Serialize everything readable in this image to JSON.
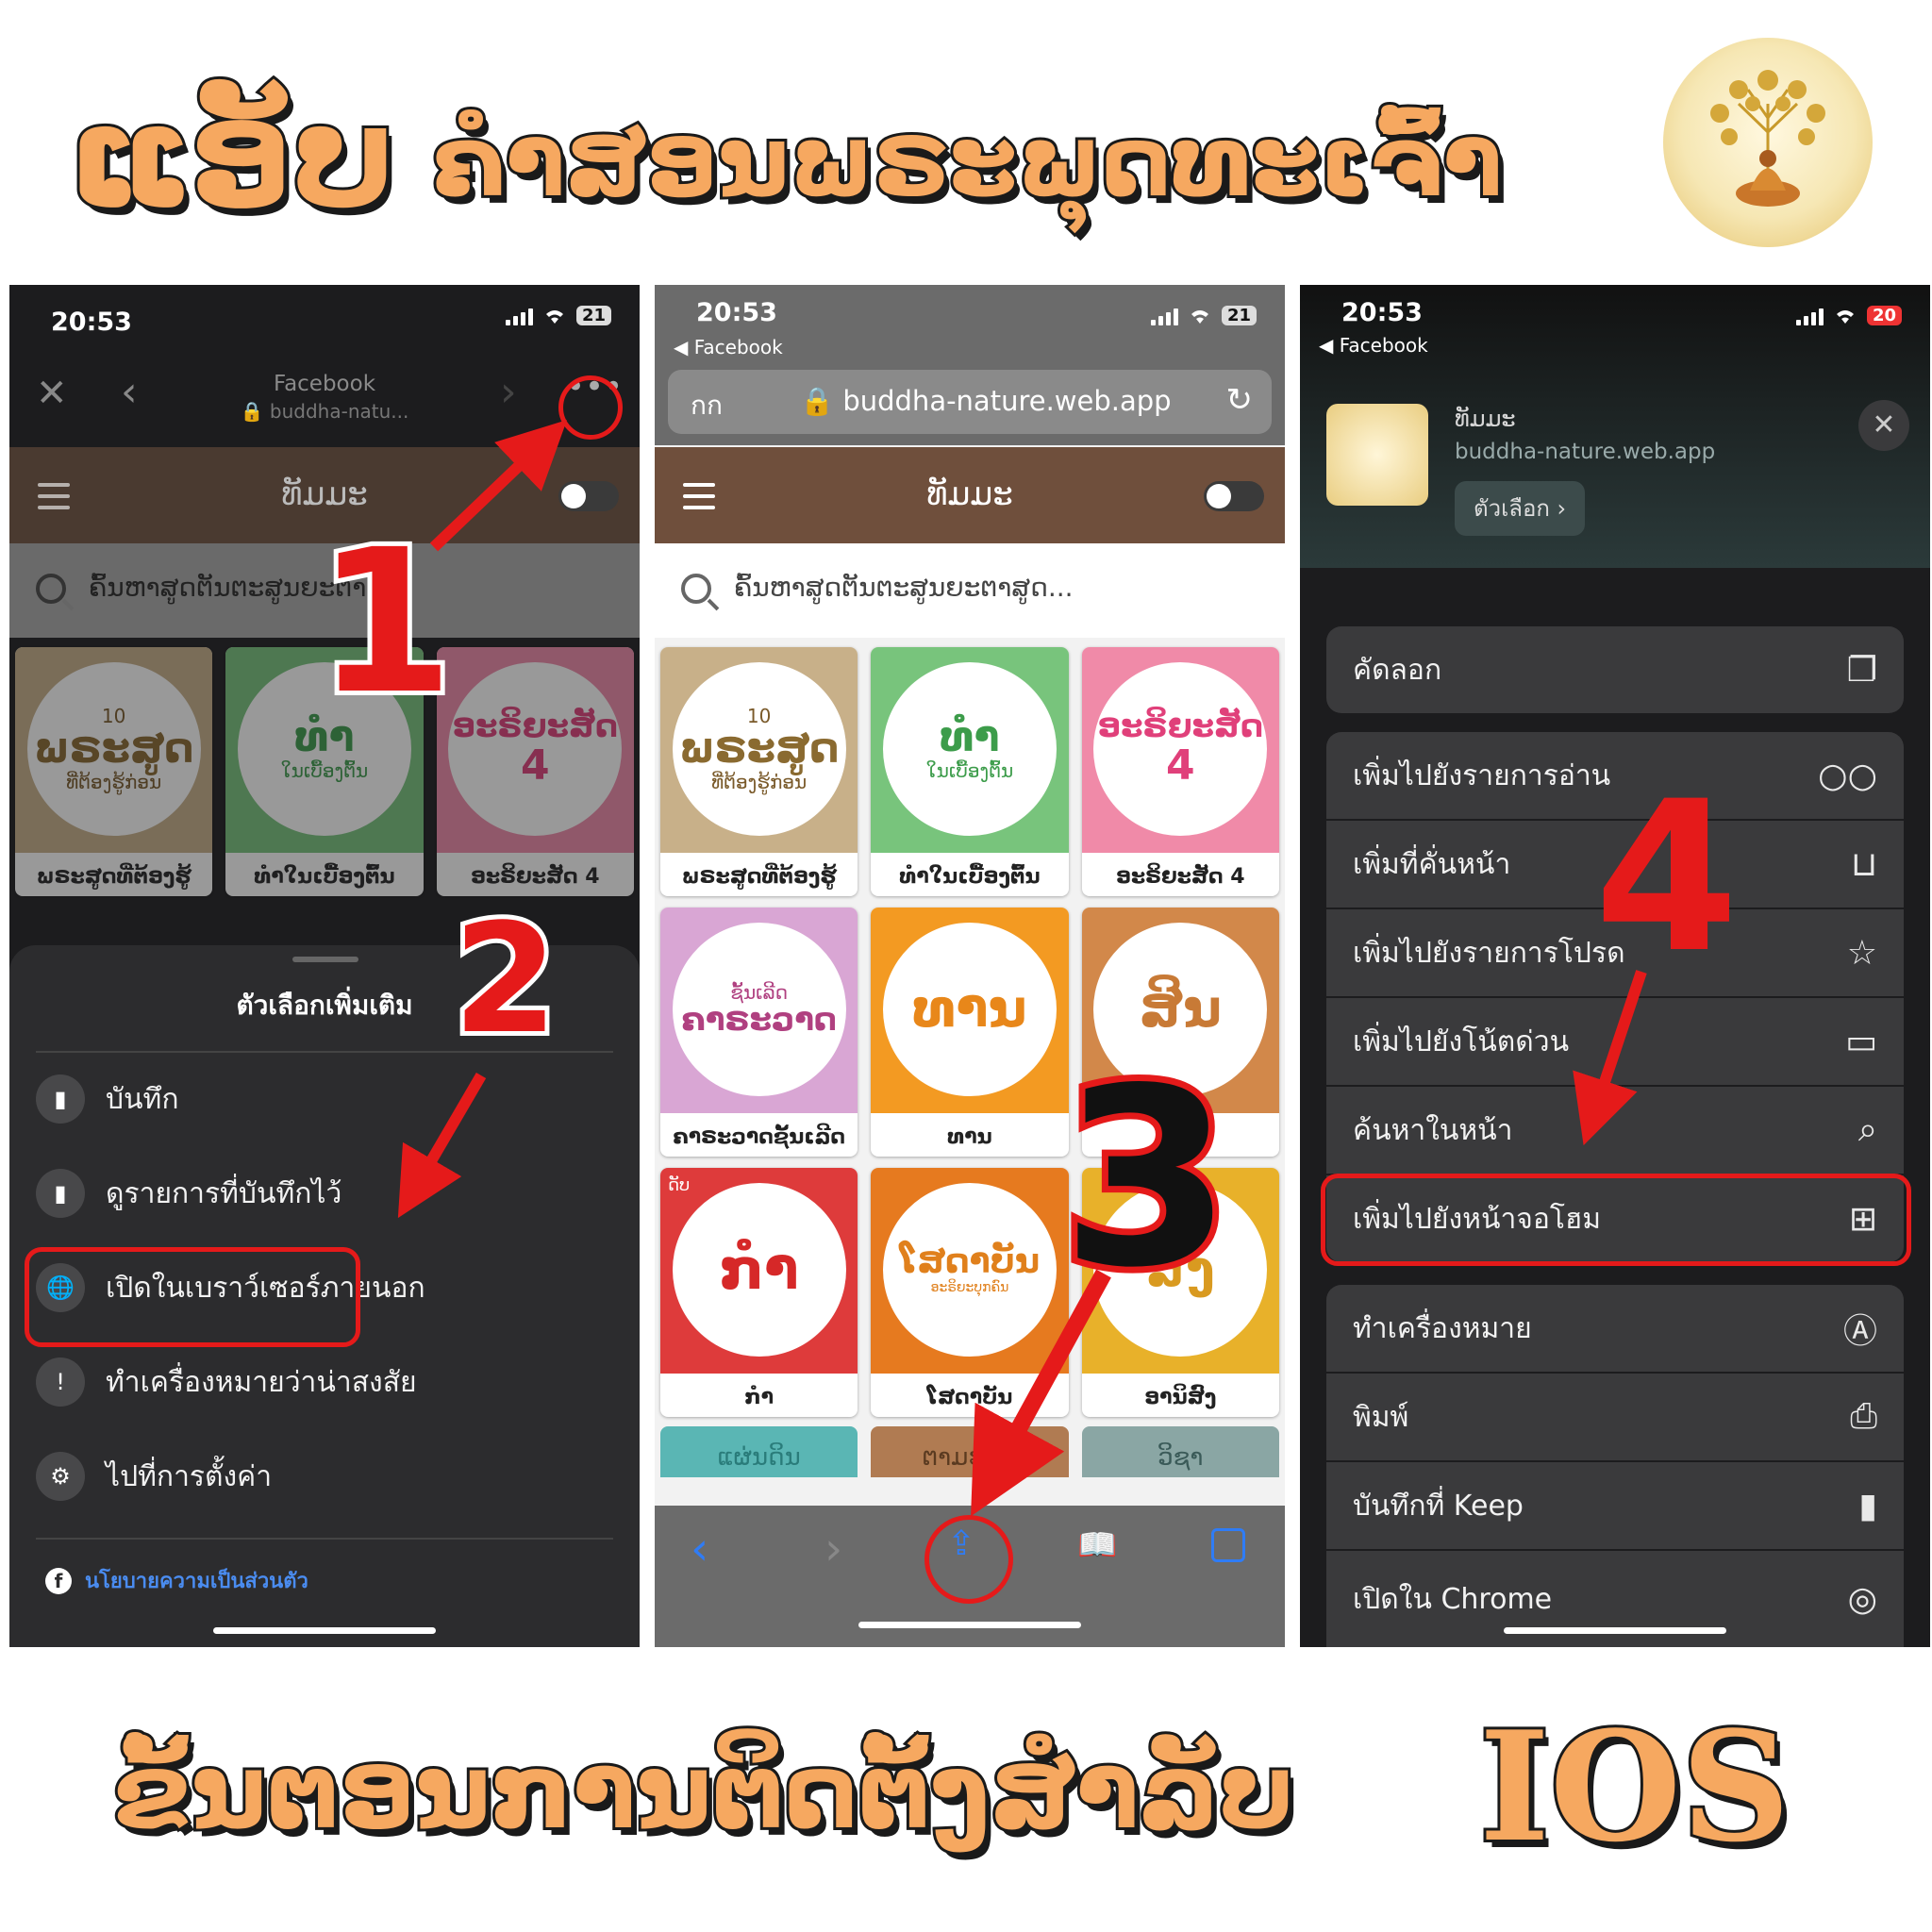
{
  "header": {
    "title_app": "ແອັບ",
    "title_rest": "ຄຳສອນພຣະພຸດທະເຈົ້າ"
  },
  "footer": {
    "title": "ຂັ້ນຕອນການຕິດຕັ້ງສຳລັບ",
    "ios": "IOS"
  },
  "steps": [
    "1",
    "2",
    "3",
    "4"
  ],
  "colors": {
    "accent": "#f6a860",
    "red": "#e51a1a",
    "brown": "#6f4f3c",
    "sheet": "#2c2c2e"
  },
  "phone1": {
    "time": "20:53",
    "battery": "21",
    "browser_title": "Facebook",
    "browser_url": "buddha-natu...",
    "app_title": "ທັມມະ",
    "search_placeholder": "ຄົ້ນຫາສູດຕັນຕະສູນຍະຕາ...",
    "cards": [
      {
        "main": "ພຣະສູດ",
        "top": "10",
        "sub": "ທີ່ຕ້ອງຮູ້ກ່ອນ",
        "label": "ພຣະສູດທີ່ຕ້ອງຮູ້"
      },
      {
        "main": "ທຳ",
        "top": "",
        "sub": "ໃນເບື້ອງຕົ້ນ",
        "label": "ທຳໃນເບື້ອງຕົ້ນ"
      },
      {
        "main": "ອະຣິຍະສັດ",
        "top": "",
        "sub": "4",
        "label": "ອະຣິຍະສັດ 4"
      }
    ],
    "sheet_title": "ตัวเลือกเพิ่มเติม",
    "menu": [
      {
        "icon": "bookmark-icon",
        "label": "บันทึก"
      },
      {
        "icon": "saved-list-icon",
        "label": "ดูรายการที่บันทึกไว้"
      },
      {
        "icon": "globe-icon",
        "label": "เปิดในเบราว์เซอร์ภายนอก"
      },
      {
        "icon": "alert-icon",
        "label": "ทำเครื่องหมายว่าน่าสงสัย"
      },
      {
        "icon": "gear-icon",
        "label": "ไปที่การตั้งค่า"
      }
    ],
    "privacy": "นโยบายความเป็นส่วนตัว"
  },
  "phone2": {
    "time": "20:53",
    "back_app": "◀ Facebook",
    "battery": "21",
    "aa": "กก",
    "url": "buddha-nature.web.app",
    "app_title": "ທັມມະ",
    "search_placeholder": "ຄົ້ນຫາສູດຕັນຕະສູນຍະຕາສູດ...",
    "cards": [
      {
        "main": "ພຣະສູດ",
        "top": "10",
        "sub": "ທີ່ຕ້ອງຮູ້ກ່ອນ",
        "label": "ພຣະສູດທີ່ຕ້ອງຮູ້",
        "bg": "#c8b089"
      },
      {
        "main": "ທຳ",
        "top": "",
        "sub": "ໃນເບື້ອງຕົ້ນ",
        "label": "ທຳໃນເບື້ອງຕົ້ນ",
        "bg": "#78c47c"
      },
      {
        "main": "ອະຣິຍະສັດ",
        "top": "",
        "sub": "4",
        "label": "ອະຣິຍະສັດ 4",
        "bg": "#f08aa8"
      },
      {
        "main": "ຄາຣະວາດ",
        "top": "ຊັ້ນເລີດ",
        "sub": "",
        "label": "ຄາຣະວາດຊັ້ນເລີດ",
        "bg": "#d9a6d4"
      },
      {
        "main": "ທານ",
        "top": "",
        "sub": "",
        "label": "ທານ",
        "bg": "#f39a22"
      },
      {
        "main": "ສິນ",
        "top": "",
        "sub": "",
        "label": "",
        "bg": "#d2884a"
      },
      {
        "main": "ກຳ",
        "top": "ດັບ",
        "sub": "",
        "label": "ກຳ",
        "bg": "#de3b3b"
      },
      {
        "main": "ໂສດາບັນ",
        "top": "",
        "sub": "ອະຣິຍະບຸກຄົນ",
        "label": "ໂສດາບັນ",
        "bg": "#e67a1f"
      },
      {
        "main": "ສົງ",
        "top": "",
        "sub": "",
        "label": "ອານິສົງ",
        "bg": "#e8b12a"
      }
    ],
    "partial_cards": [
      "ແຜ່ນດິນ",
      "ຕາມຮອຍ",
      "ວິຊາ"
    ]
  },
  "phone3": {
    "time": "20:53",
    "back_app": "◀ Facebook",
    "battery": "20",
    "site_name": "ທັມມະ",
    "site_url": "buddha-nature.web.app",
    "options_label": "ตัวเลือก",
    "copy": {
      "label": "คัดลอก",
      "icon": "copy-icon"
    },
    "group1": [
      {
        "label": "เพิ่มไปยังรายการอ่าน",
        "icon": "glasses-icon",
        "sym": "○○"
      },
      {
        "label": "เพิ่มที่คั่นหน้า",
        "icon": "book-icon",
        "sym": "⊔"
      },
      {
        "label": "เพิ่มไปยังรายการโปรด",
        "icon": "star-icon",
        "sym": "☆"
      },
      {
        "label": "เพิ่มไปยังโน้ตด่วน",
        "icon": "quick-note-icon",
        "sym": "▭"
      },
      {
        "label": "ค้นหาในหน้า",
        "icon": "find-icon",
        "sym": "⌕"
      },
      {
        "label": "เพิ่มไปยังหน้าจอโฮม",
        "icon": "add-square-icon",
        "sym": "⊞"
      }
    ],
    "group2": [
      {
        "label": "ทำเครื่องหมาย",
        "icon": "markup-icon",
        "sym": "Ⓐ"
      },
      {
        "label": "พิมพ์",
        "icon": "printer-icon",
        "sym": "⎙"
      },
      {
        "label": "บันทึกที่ Keep",
        "icon": "keep-bookmark-icon",
        "sym": "▮"
      },
      {
        "label": "เปิดใน Chrome",
        "icon": "chrome-icon",
        "sym": "◎"
      }
    ]
  }
}
